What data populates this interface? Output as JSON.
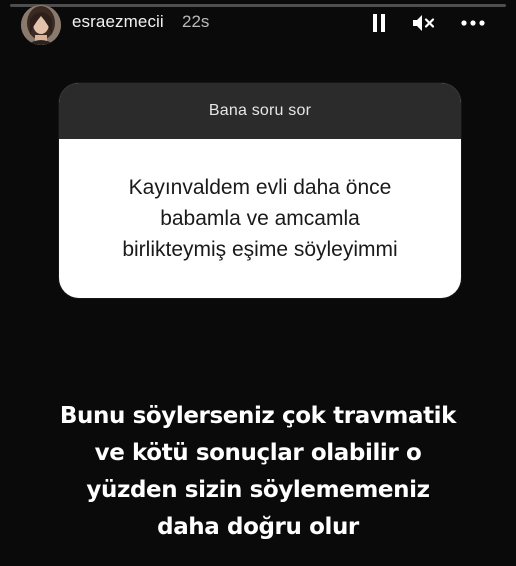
{
  "story": {
    "progress": 0,
    "username": "esraezmecii",
    "timestamp": "22s",
    "controls": {
      "pause_icon": "pause-icon",
      "mute_icon": "speaker-muted-icon",
      "more_icon": "more-dots-icon"
    }
  },
  "question_sticker": {
    "title": "Bana soru sor",
    "lines": [
      "Kayınvaldem evli daha önce",
      "babamla ve amcamla",
      "birlikteymiş  eşime söyleyimmi"
    ]
  },
  "answer": {
    "lines": [
      "Bunu söylerseniz çok travmatik",
      "ve kötü sonuçlar olabilir o",
      "yüzden sizin söylememeniz",
      "daha doğru olur"
    ]
  },
  "colors": {
    "background": "#0a0a0a",
    "card_header": "#2b2b2b",
    "card_body": "#ffffff",
    "text_primary": "#ffffff"
  }
}
